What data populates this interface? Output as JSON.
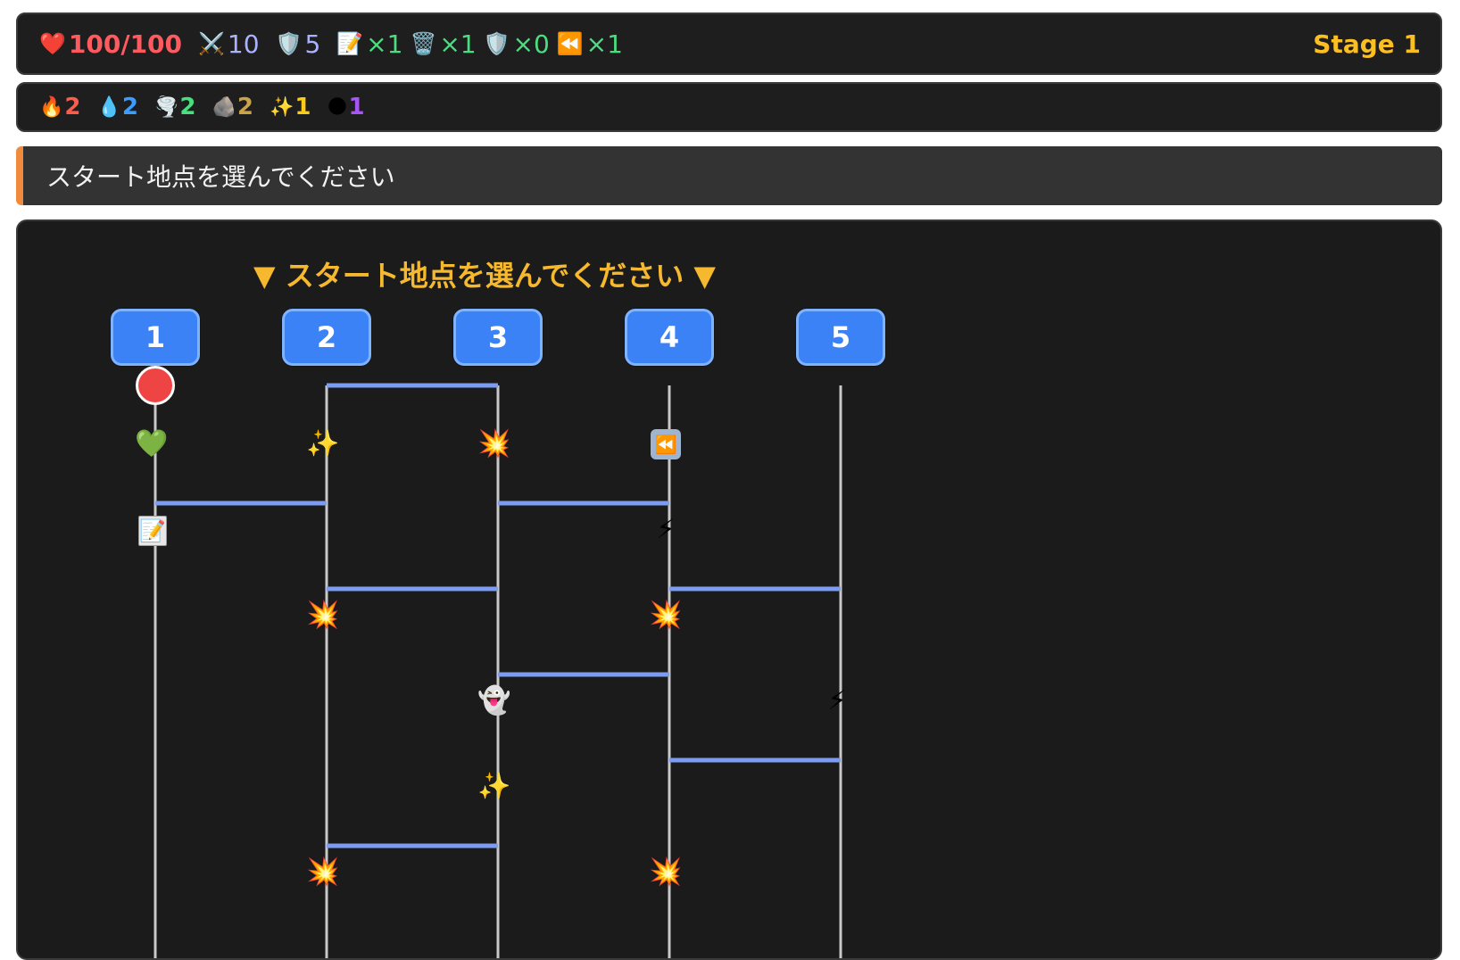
{
  "status": {
    "hp": {
      "icon": "❤️",
      "value": "100/100"
    },
    "attack": {
      "icon": "⚔️",
      "value": "10"
    },
    "defense": {
      "icon": "🛡️",
      "value": "5"
    },
    "items": [
      {
        "icon": "📝",
        "name": "memo-item",
        "value": "×1"
      },
      {
        "icon": "🗑️",
        "name": "trash-item",
        "value": "×1"
      },
      {
        "icon": "🛡️",
        "name": "shield-item",
        "value": "×0"
      },
      {
        "icon": "⏪",
        "name": "rewind-item",
        "value": "×1"
      }
    ],
    "stage": "Stage 1"
  },
  "elements": [
    {
      "icon": "🔥",
      "name": "fire",
      "value": "2",
      "color": "#ff5a4a"
    },
    {
      "icon": "💧",
      "name": "water",
      "value": "2",
      "color": "#3b9dff"
    },
    {
      "icon": "🌪️",
      "name": "wind",
      "value": "2",
      "color": "#4ade80"
    },
    {
      "icon": "🪨",
      "name": "earth",
      "value": "2",
      "color": "#c9a24a"
    },
    {
      "icon": "✨",
      "name": "light",
      "value": "1",
      "color": "#facc15"
    },
    {
      "icon": "🌑",
      "name": "dark",
      "value": "1",
      "color": "#a855f7"
    }
  ],
  "message": "スタート地点を選んでください",
  "board": {
    "prompt": "▼ スタート地点を選んでください ▼",
    "columns": [
      "1",
      "2",
      "3",
      "4",
      "5"
    ],
    "start_column": 1,
    "rungs": [
      {
        "from": 2,
        "to": 3,
        "row": 0
      },
      {
        "from": 1,
        "to": 2,
        "row": 1
      },
      {
        "from": 3,
        "to": 4,
        "row": 1
      },
      {
        "from": 2,
        "to": 3,
        "row": 2
      },
      {
        "from": 4,
        "to": 5,
        "row": 2
      },
      {
        "from": 3,
        "to": 4,
        "row": 3
      },
      {
        "from": 4,
        "to": 5,
        "row": 4
      },
      {
        "from": 2,
        "to": 3,
        "row": 5
      }
    ],
    "cells": [
      {
        "col": 1,
        "row": 0,
        "icon": "💚",
        "name": "heal-heart-icon"
      },
      {
        "col": 2,
        "row": 0,
        "icon": "✨",
        "name": "sparkle-icon"
      },
      {
        "col": 3,
        "row": 0,
        "icon": "💥",
        "name": "explosion-icon"
      },
      {
        "col": 4,
        "row": 0,
        "icon": "⏪",
        "name": "rewind-icon"
      },
      {
        "col": 1,
        "row": 1,
        "icon": "📝",
        "name": "memo-icon"
      },
      {
        "col": 4,
        "row": 1,
        "icon": "⚡",
        "name": "lightning-icon"
      },
      {
        "col": 2,
        "row": 2,
        "icon": "💥",
        "name": "explosion-icon"
      },
      {
        "col": 4,
        "row": 2,
        "icon": "💥",
        "name": "explosion-icon"
      },
      {
        "col": 3,
        "row": 3,
        "icon": "👻",
        "name": "ghost-icon"
      },
      {
        "col": 5,
        "row": 3,
        "icon": "⚡",
        "name": "lightning-icon"
      },
      {
        "col": 3,
        "row": 4,
        "icon": "✨",
        "name": "sparkle-icon"
      },
      {
        "col": 2,
        "row": 5,
        "icon": "💥",
        "name": "explosion-icon"
      },
      {
        "col": 4,
        "row": 5,
        "icon": "💥",
        "name": "explosion-icon"
      }
    ]
  }
}
